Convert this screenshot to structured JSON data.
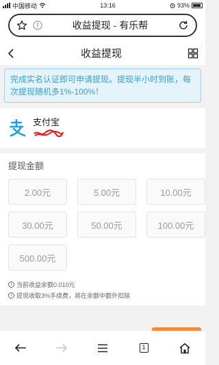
{
  "status_bar": {
    "carrier": "中国移动",
    "time": "13:16",
    "battery": "93%"
  },
  "browser": {
    "page_title": "收益提现 - 有乐帮"
  },
  "header": {
    "title": "收益提现"
  },
  "notice": {
    "text": "完成实名认证即可申请提现。提现半小时到账，每次提现随机多1%-100%！"
  },
  "payment": {
    "method_label": "支付宝"
  },
  "amount": {
    "title": "提现金额",
    "options": [
      "2.00元",
      "5.00元",
      "10.00元",
      "30.00元",
      "50.00元",
      "100.00元",
      "500.00元"
    ]
  },
  "hints": {
    "balance": "当前收益余额0.010元",
    "fee": "提现收取3%手续费，将在余额中额外扣除"
  },
  "bottom_nav": {
    "page_count": "1"
  },
  "colors": {
    "accent_blue": "#38a0d6",
    "notice_bg": "#e5f3fb",
    "alipay_blue": "#1a9fe0",
    "scribble_red": "#e02020",
    "orange": "#f08a3c"
  }
}
